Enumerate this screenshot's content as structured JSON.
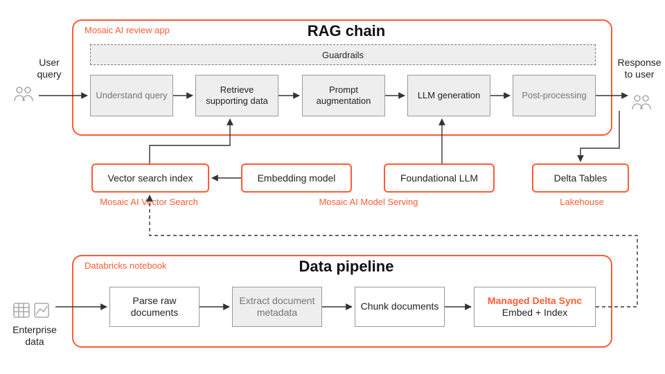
{
  "rag": {
    "outer_label": "Mosaic AI review app",
    "title": "RAG chain",
    "guardrails": "Guardrails",
    "stages": {
      "understand": "Understand query",
      "retrieve": "Retrieve supporting data",
      "prompt_aug": "Prompt augmentation",
      "llm_gen": "LLM generation",
      "post": "Post-processing"
    }
  },
  "side": {
    "user_query": "User query",
    "response": "Response to user",
    "enterprise_data": "Enterprise data"
  },
  "middle": {
    "vector_search": "Vector search index",
    "embedding": "Embedding model",
    "foundation_llm": "Foundational LLM",
    "delta_tables": "Delta Tables",
    "sub_vector": "Mosaic AI Vector Search",
    "sub_serving": "Mosaic AI Model Serving",
    "sub_lakehouse": "Lakehouse"
  },
  "pipeline": {
    "outer_label": "Databricks notebook",
    "title": "Data pipeline",
    "parse": "Parse raw documents",
    "extract": "Extract document metadata",
    "chunk": "Chunk documents",
    "sync_title": "Managed Delta Sync",
    "sync_sub": "Embed + Index"
  }
}
